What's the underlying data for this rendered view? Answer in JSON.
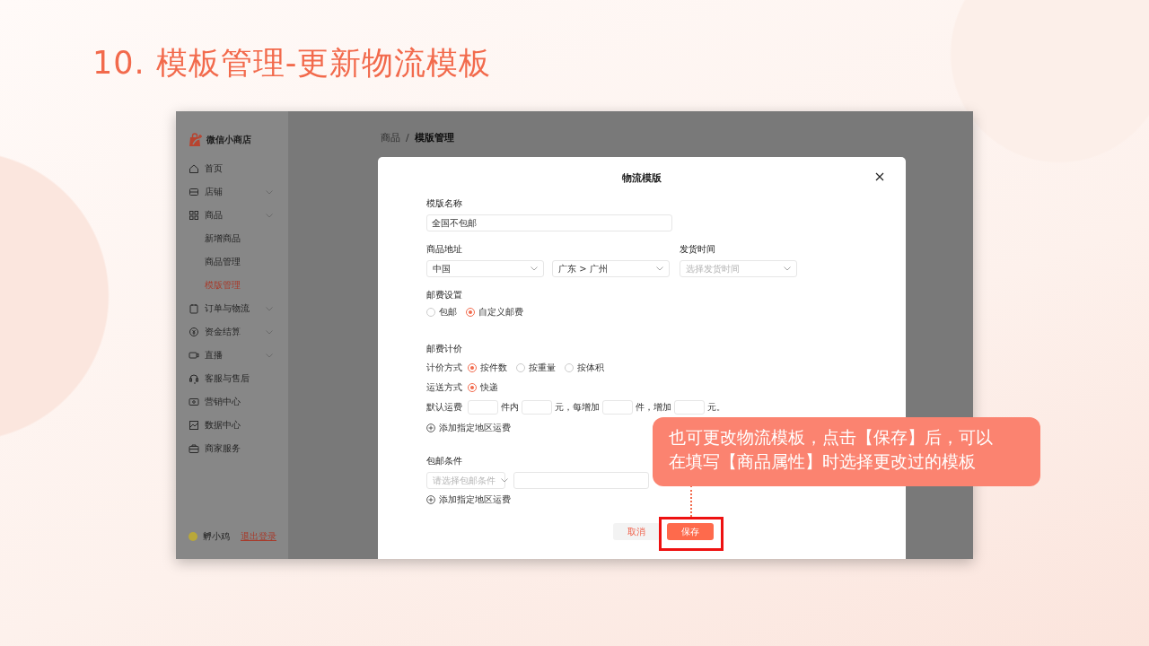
{
  "slide_title": "10. 模板管理-更新物流模板",
  "app": {
    "brand": "微信小商店",
    "sidebar": {
      "items": [
        {
          "label": "首页",
          "expandable": false,
          "selected": false
        },
        {
          "label": "店铺",
          "expandable": true,
          "selected": false
        },
        {
          "label": "商品",
          "expandable": true,
          "selected": false,
          "children": [
            {
              "label": "新增商品",
              "expandable": false,
              "selected": false
            },
            {
              "label": "商品管理",
              "expandable": false,
              "selected": false
            },
            {
              "label": "模版管理",
              "expandable": false,
              "selected": true
            }
          ]
        },
        {
          "label": "订单与物流",
          "expandable": true,
          "selected": false
        },
        {
          "label": "资金结算",
          "expandable": true,
          "selected": false
        },
        {
          "label": "直播",
          "expandable": true,
          "selected": false
        },
        {
          "label": "客服与售后",
          "expandable": false,
          "selected": false
        },
        {
          "label": "营销中心",
          "expandable": false,
          "selected": false
        },
        {
          "label": "数据中心",
          "expandable": false,
          "selected": false
        },
        {
          "label": "商家服务",
          "expandable": false,
          "selected": false
        }
      ]
    },
    "user": {
      "name": "孵小鸡",
      "logout": "退出登录"
    },
    "breadcrumb": {
      "separator": "/",
      "items": [
        {
          "label": "商品",
          "current": false
        },
        {
          "label": "模版管理",
          "current": true
        }
      ]
    },
    "dialog": {
      "title": "物流模版",
      "template_name": {
        "label": "模版名称",
        "value": "全国不包邮"
      },
      "address": {
        "label": "商品地址",
        "selects": [
          {
            "value": "中国"
          },
          {
            "value": "广东 > 广州"
          }
        ]
      },
      "ship_time": {
        "label": "发货时间",
        "placeholder": "选择发货时间"
      },
      "postage_setting": {
        "label": "邮费设置",
        "options": [
          {
            "label": "包邮",
            "selected": false
          },
          {
            "label": "自定义邮费",
            "selected": true
          }
        ]
      },
      "pricing": {
        "heading": "邮费计价",
        "method": {
          "label": "计价方式",
          "options": [
            {
              "label": "按件数",
              "selected": true
            },
            {
              "label": "按重量",
              "selected": false
            },
            {
              "label": "按体积",
              "selected": false
            }
          ]
        },
        "delivery": {
          "label": "运送方式",
          "options": [
            {
              "label": "快递",
              "selected": true
            }
          ]
        },
        "default_fee": {
          "label": "默认运费",
          "units": [
            "件内",
            "元，每增加",
            "件，增加",
            "元。"
          ]
        },
        "add_region": "添加指定地区运费"
      },
      "free_shipping": {
        "heading": "包邮条件",
        "placeholder": "请选择包邮条件",
        "add_region": "添加指定地区运费"
      },
      "buttons": [
        {
          "label": "取消",
          "kind": "secondary"
        },
        {
          "label": "保存",
          "kind": "primary"
        }
      ]
    }
  },
  "callout": {
    "text": "也可更改物流模板，点击【保存】后，可以在填写【商品属性】时选择更改过的模板"
  }
}
